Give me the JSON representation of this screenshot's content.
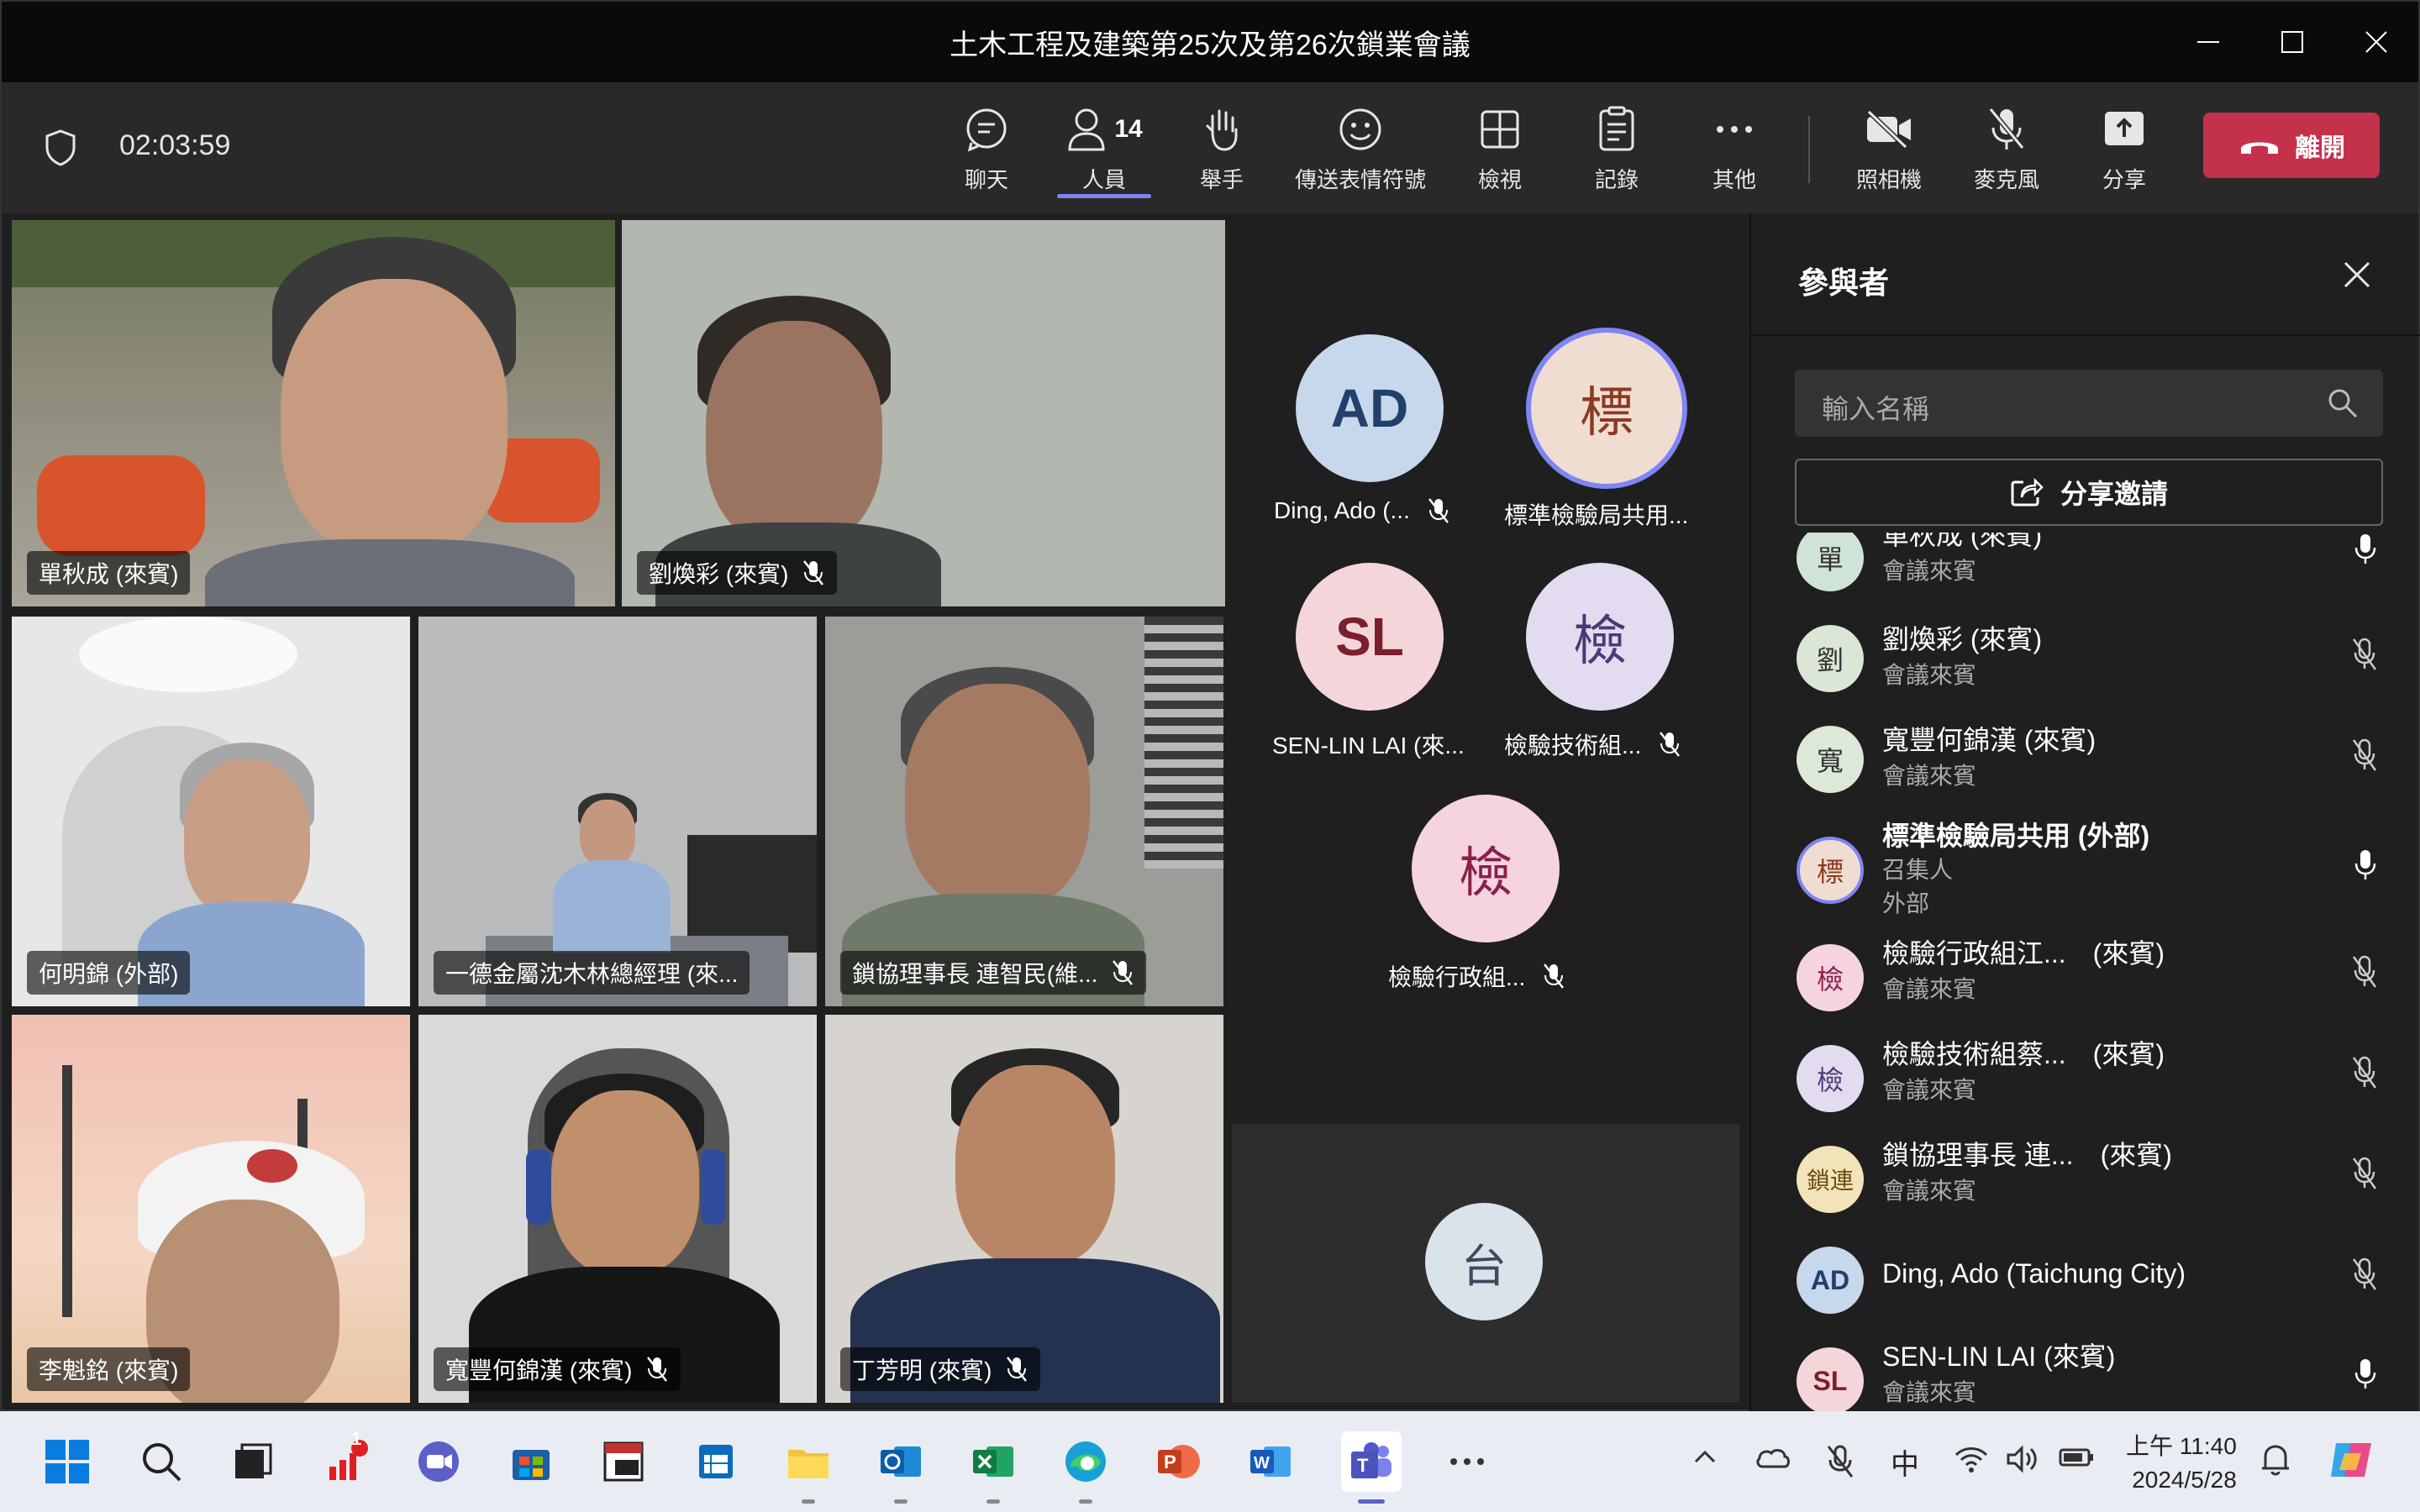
{
  "window": {
    "title": "土木工程及建築第25次及第26次鎖業會議"
  },
  "toolbar": {
    "timer": "02:03:59",
    "chat_label": "聊天",
    "people_label": "人員",
    "people_count": "14",
    "raise_hand_label": "舉手",
    "reactions_label": "傳送表情符號",
    "view_label": "檢視",
    "notes_label": "記錄",
    "more_label": "其他",
    "camera_label": "照相機",
    "mic_label": "麥克風",
    "share_label": "分享",
    "leave_label": "離開",
    "leave_color": "#c4314b",
    "accent_color": "#7f85f5"
  },
  "video_tiles": [
    {
      "name": "單秋成 (來賓)",
      "muted": false
    },
    {
      "name": "劉煥彩 (來賓)",
      "muted": true
    },
    {
      "name": "何明錦 (外部)",
      "muted": false
    },
    {
      "name": "一德金屬沈木林總經理 (來...",
      "muted": false
    },
    {
      "name": "鎖協理事長 連智民(維...",
      "muted": true
    },
    {
      "name": "李魁銘 (來賓)",
      "muted": false
    },
    {
      "name": "寬豐何錦漢 (來賓)",
      "muted": true
    },
    {
      "name": "丁芳明 (來賓)",
      "muted": true
    }
  ],
  "avatar_tiles": [
    {
      "initials": "AD",
      "name": "Ding, Ado (...",
      "muted": true
    },
    {
      "initials": "標",
      "name": "標準檢驗局共用...",
      "muted": false
    },
    {
      "initials": "SL",
      "name": "SEN-LIN LAI (來...",
      "muted": false
    },
    {
      "initials": "檢",
      "name": "檢驗技術組...",
      "muted": true
    },
    {
      "initials": "檢",
      "name": "檢驗行政組...",
      "muted": true
    },
    {
      "initials": "台",
      "name": "",
      "muted": false
    }
  ],
  "panel": {
    "title": "參與者",
    "search_placeholder": "輸入名稱",
    "share_invite_label": "分享邀請",
    "participants": [
      {
        "initials": "單",
        "name": "單秋成 (來賓)",
        "role": "會議來賓",
        "role2": "",
        "muted": false
      },
      {
        "initials": "劉",
        "name": "劉煥彩 (來賓)",
        "role": "會議來賓",
        "role2": "",
        "muted": true
      },
      {
        "initials": "寬",
        "name": "寬豐何錦漢 (來賓)",
        "role": "會議來賓",
        "role2": "",
        "muted": true
      },
      {
        "initials": "標",
        "name": "標準檢驗局共用 (外部)",
        "role": "召集人",
        "role2": "外部",
        "muted": false
      },
      {
        "initials": "檢",
        "name": "檢驗行政組江...　(來賓)",
        "role": "會議來賓",
        "role2": "",
        "muted": true
      },
      {
        "initials": "檢",
        "name": "檢驗技術組蔡...　(來賓)",
        "role": "會議來賓",
        "role2": "",
        "muted": true
      },
      {
        "initials": "鎖連",
        "name": "鎖協理事長 連...　(來賓)",
        "role": "會議來賓",
        "role2": "",
        "muted": true
      },
      {
        "initials": "AD",
        "name": "Ding, Ado (Taichung City)",
        "role": "",
        "role2": "",
        "muted": true
      },
      {
        "initials": "SL",
        "name": "SEN-LIN LAI (來賓)",
        "role": "會議來賓",
        "role2": "",
        "muted": false
      }
    ]
  },
  "taskbar": {
    "notification_badge": "1",
    "ime_label": "中",
    "time": "上午 11:40",
    "date": "2024/5/28"
  }
}
